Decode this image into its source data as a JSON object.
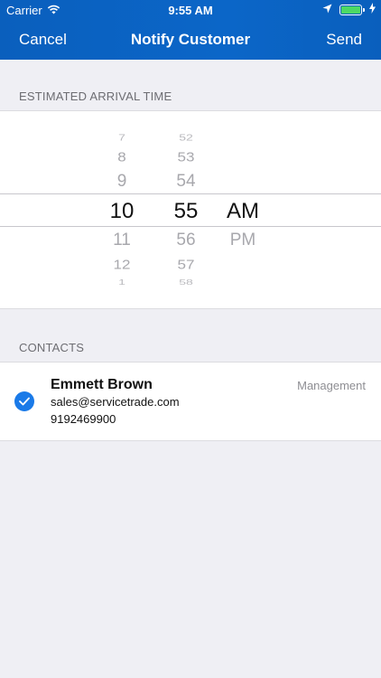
{
  "status_bar": {
    "carrier": "Carrier",
    "time": "9:55 AM",
    "battery_color": "#4cd964"
  },
  "nav": {
    "cancel_label": "Cancel",
    "title": "Notify Customer",
    "send_label": "Send",
    "background": "#0b66c8"
  },
  "arrival": {
    "section_title": "ESTIMATED ARRIVAL TIME",
    "hours": [
      "7",
      "8",
      "9",
      "10",
      "11",
      "12",
      "1"
    ],
    "minutes": [
      "52",
      "53",
      "54",
      "55",
      "56",
      "57",
      "58"
    ],
    "periods": [
      "AM",
      "PM"
    ],
    "selected_hour": "10",
    "selected_minute": "55",
    "selected_period": "AM"
  },
  "contacts": {
    "section_title": "CONTACTS",
    "items": [
      {
        "name": "Emmett Brown",
        "email": "sales@servicetrade.com",
        "phone": "9192469900",
        "role": "Management",
        "selected": true,
        "check_color": "#1a7ae8"
      }
    ]
  }
}
